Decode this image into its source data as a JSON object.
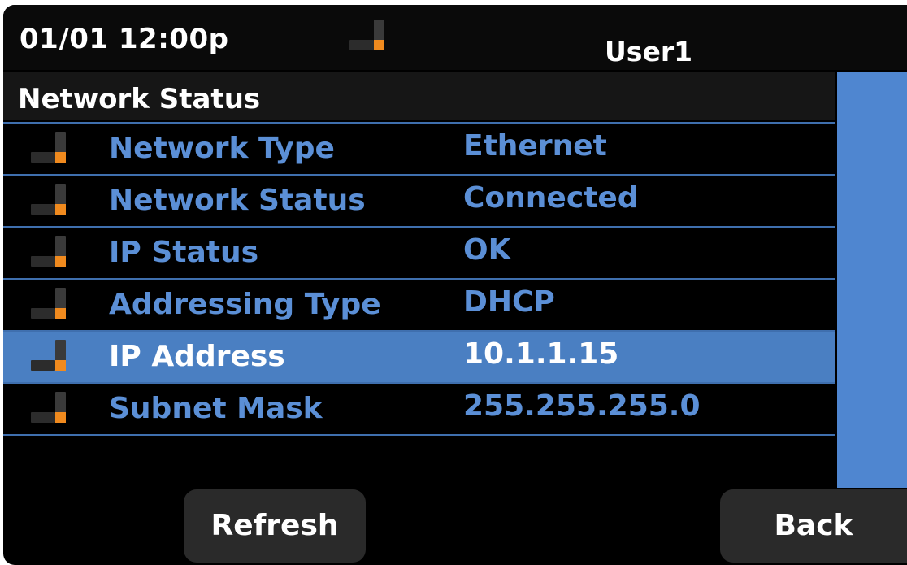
{
  "status_bar": {
    "datetime": "01/01 12:00p",
    "user": "User1",
    "network_icon": "network-icon"
  },
  "screen": {
    "title": "Network Status"
  },
  "rows": [
    {
      "label": "Network Type",
      "value": "Ethernet",
      "icon": "network-icon",
      "selected": false
    },
    {
      "label": "Network Status",
      "value": "Connected",
      "icon": "network-icon",
      "selected": false
    },
    {
      "label": "IP Status",
      "value": "OK",
      "icon": "network-icon",
      "selected": false
    },
    {
      "label": "Addressing Type",
      "value": "DHCP",
      "icon": "network-icon",
      "selected": false
    },
    {
      "label": "IP Address",
      "value": "10.1.1.15",
      "icon": "network-icon",
      "selected": true
    },
    {
      "label": "Subnet Mask",
      "value": "255.255.255.0",
      "icon": "network-icon",
      "selected": false
    }
  ],
  "softkeys": {
    "refresh": "Refresh",
    "back": "Back"
  },
  "colors": {
    "accent": "#4a7fc2",
    "label_text": "#5b8fd6",
    "icon_orange": "#f08a1e",
    "scrollbar": "#4f86d0"
  }
}
